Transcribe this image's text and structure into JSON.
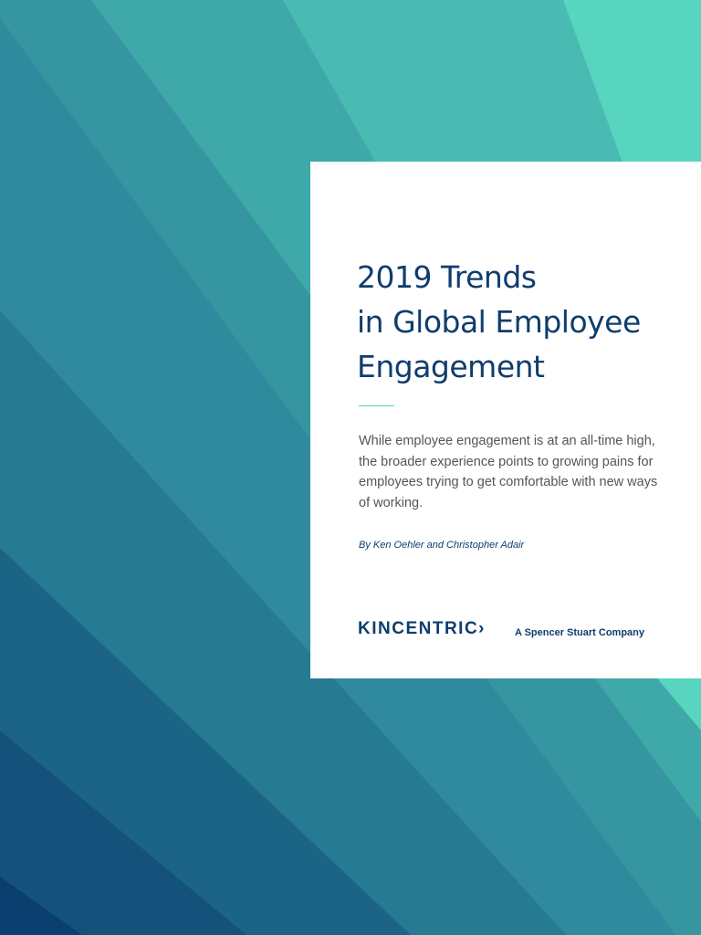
{
  "cover": {
    "title_lines": [
      "2019 Trends",
      "in Global Employee",
      "Engagement"
    ],
    "description": "While employee engagement is at an all-time high, the broader experience points to growing pains for employees trying to get comfortable with new ways of working.",
    "byline": "By Ken Oehler and Christopher Adair",
    "logo_text": "KINCENTRIC›",
    "tagline": "A Spencer Stuart Company"
  },
  "colors": {
    "title": "#0f3d6e",
    "accent": "#56d4bd",
    "bands": [
      "#14527c",
      "#1c6485",
      "#267a92",
      "#2e8a9c",
      "#3596a2",
      "#3fa8a8",
      "#4abbb2",
      "#57d5bf"
    ]
  }
}
